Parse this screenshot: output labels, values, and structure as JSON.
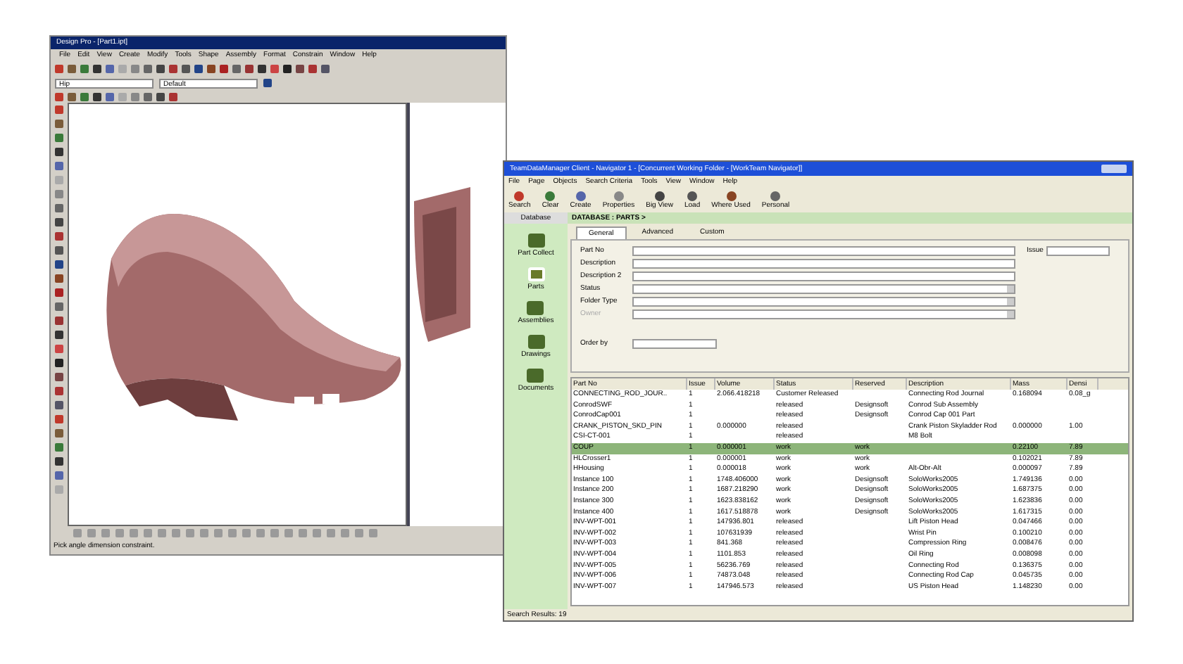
{
  "cad_window": {
    "title": "Design Pro - [Part1.ipt]",
    "menu": [
      "File",
      "Edit",
      "View",
      "Create",
      "Modify",
      "Tools",
      "Shape",
      "Assembly",
      "Format",
      "Constrain",
      "Window",
      "Help"
    ],
    "combo_1": "Hip",
    "combo_2": "Default",
    "status_bar": "Pick angle dimension constraint."
  },
  "pdm_window": {
    "title": "TeamDataManager Client - Navigator 1 - [Concurrent Working Folder - [WorkTeam Navigator]]",
    "menu": [
      "File",
      "Page",
      "Objects",
      "Search Criteria",
      "Tools",
      "View",
      "Window",
      "Help"
    ],
    "toolbar": [
      "Search",
      "Clear",
      "Create",
      "Properties",
      "Big View",
      "Load",
      "Where Used",
      "Personal"
    ],
    "breadcrumb": "DATABASE : PARTS >",
    "sidebar": {
      "header": "Database",
      "items": [
        {
          "label": "Part Collect",
          "selected": false
        },
        {
          "label": "Parts",
          "selected": true
        },
        {
          "label": "Assemblies",
          "selected": false
        },
        {
          "label": "Drawings",
          "selected": false
        },
        {
          "label": "Documents",
          "selected": false
        }
      ]
    },
    "tabs": [
      {
        "label": "General",
        "selected": true
      },
      {
        "label": "Advanced",
        "selected": false
      },
      {
        "label": "Custom",
        "selected": false
      }
    ],
    "fields": [
      {
        "label": "Part No",
        "kind": "text",
        "disabled": false
      },
      {
        "label": "Description",
        "kind": "text",
        "disabled": false
      },
      {
        "label": "Description 2",
        "kind": "text",
        "disabled": false
      },
      {
        "label": "Status",
        "kind": "select",
        "disabled": false
      },
      {
        "label": "Folder Type",
        "kind": "select",
        "disabled": false
      },
      {
        "label": "Owner",
        "kind": "select",
        "disabled": true
      }
    ],
    "issue_field": "Issue",
    "order_by": "Order by",
    "table": {
      "columns": [
        "Part No",
        "Issue",
        "Volume",
        "Status",
        "Reserved",
        "Description",
        "Mass",
        "Densi"
      ],
      "rows": [
        {
          "cells": [
            "CONNECTING_ROD_JOUR..",
            "1",
            "2.066.418218",
            "Customer Released",
            "",
            "Connecting Rod Journal",
            "0.168094",
            "0.08_g"
          ],
          "selected": false
        },
        {
          "cells": [
            "ConrodSWF",
            "1",
            "",
            "released",
            "Designsoft",
            "Conrod Sub Assembly",
            "",
            ""
          ],
          "selected": false
        },
        {
          "cells": [
            "ConrodCap001",
            "1",
            "",
            "released",
            "Designsoft",
            "Conrod Cap 001 Part",
            "",
            ""
          ],
          "selected": false
        },
        {
          "cells": [
            "CRANK_PISTON_SKD_PIN",
            "1",
            "0.000000",
            "released",
            "",
            "Crank Piston Skyladder Rod",
            "0.000000",
            "1.00"
          ],
          "selected": false
        },
        {
          "cells": [
            "CSI-CT-001",
            "1",
            "",
            "released",
            "",
            "M8 Bolt",
            "",
            ""
          ],
          "selected": false
        },
        {
          "cells": [
            "COUP",
            "1",
            "0.000001",
            "work",
            "work",
            "",
            "0.22100",
            "7.89"
          ],
          "selected": true
        },
        {
          "cells": [
            "HLCrosser1",
            "1",
            "0.000001",
            "work",
            "work",
            "",
            "0.102021",
            "7.89"
          ],
          "selected": false
        },
        {
          "cells": [
            "HHousing",
            "1",
            "0.000018",
            "work",
            "work",
            "Alt-Obr-Alt",
            "0.000097",
            "7.89"
          ],
          "selected": false
        },
        {
          "cells": [
            "Instance 100",
            "1",
            "1748.406000",
            "work",
            "Designsoft",
            "SoloWorks2005",
            "1.749136",
            "0.00"
          ],
          "selected": false
        },
        {
          "cells": [
            "Instance 200",
            "1",
            "1687.218290",
            "work",
            "Designsoft",
            "SoloWorks2005",
            "1.687375",
            "0.00"
          ],
          "selected": false
        },
        {
          "cells": [
            "Instance 300",
            "1",
            "1623.838162",
            "work",
            "Designsoft",
            "SoloWorks2005",
            "1.623836",
            "0.00"
          ],
          "selected": false
        },
        {
          "cells": [
            "Instance 400",
            "1",
            "1617.518878",
            "work",
            "Designsoft",
            "SoloWorks2005",
            "1.617315",
            "0.00"
          ],
          "selected": false
        },
        {
          "cells": [
            "INV-WPT-001",
            "1",
            "147936.801",
            "released",
            "",
            "Lift Piston Head",
            "0.047466",
            "0.00"
          ],
          "selected": false
        },
        {
          "cells": [
            "INV-WPT-002",
            "1",
            "107631939",
            "released",
            "",
            "Wrist Pin",
            "0.100210",
            "0.00"
          ],
          "selected": false
        },
        {
          "cells": [
            "INV-WPT-003",
            "1",
            "841.368",
            "released",
            "",
            "Compression Ring",
            "0.008476",
            "0.00"
          ],
          "selected": false
        },
        {
          "cells": [
            "INV-WPT-004",
            "1",
            "1101.853",
            "released",
            "",
            "Oil Ring",
            "0.008098",
            "0.00"
          ],
          "selected": false
        },
        {
          "cells": [
            "INV-WPT-005",
            "1",
            "56236.769",
            "released",
            "",
            "Connecting Rod",
            "0.136375",
            "0.00"
          ],
          "selected": false
        },
        {
          "cells": [
            "INV-WPT-006",
            "1",
            "74873.048",
            "released",
            "",
            "Connecting Rod Cap",
            "0.045735",
            "0.00"
          ],
          "selected": false
        },
        {
          "cells": [
            "INV-WPT-007",
            "1",
            "147946.573",
            "released",
            "",
            "US Piston Head",
            "1.148230",
            "0.00"
          ],
          "selected": false
        }
      ]
    },
    "status_bar": "Search Results: 19"
  }
}
